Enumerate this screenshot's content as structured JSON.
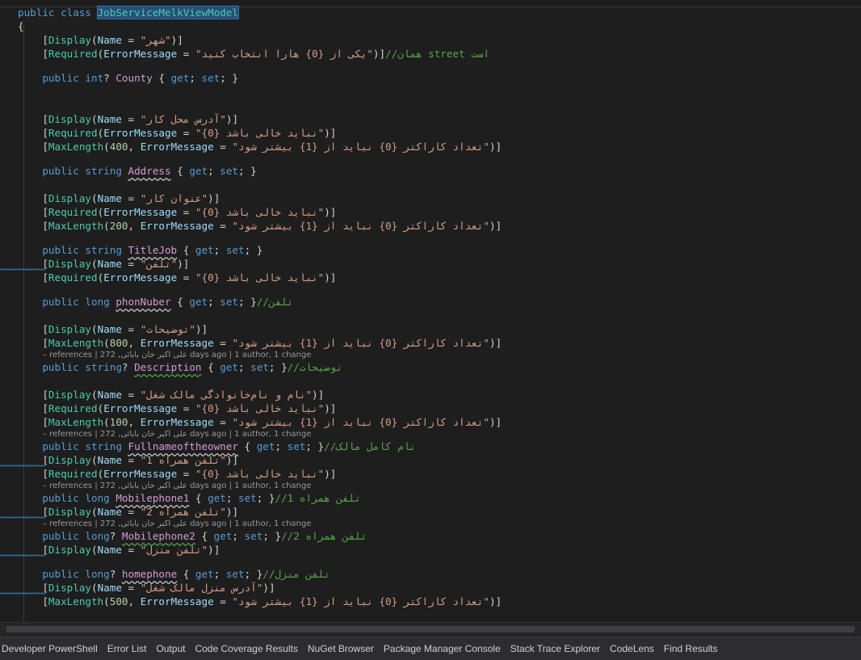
{
  "editor": {
    "lines": [
      [
        [
          "k",
          "public class "
        ],
        [
          "sel",
          "JobServiceMelkViewModel"
        ]
      ],
      [
        [
          "bk",
          "{"
        ]
      ],
      [
        [
          "bk",
          "    ["
        ],
        [
          "a",
          "Display"
        ],
        [
          "bk",
          "("
        ],
        [
          "n",
          "Name"
        ],
        [
          "bk",
          " = "
        ],
        [
          "s",
          "\"شهر\""
        ],
        [
          "bk",
          ")]"
        ]
      ],
      [
        [
          "bk",
          "    ["
        ],
        [
          "a",
          "Required"
        ],
        [
          "bk",
          "("
        ],
        [
          "n",
          "ErrorMessage"
        ],
        [
          "bk",
          " = "
        ],
        [
          "s",
          "\"یکی از {0} هارا انتخاب کنید\""
        ],
        [
          "bk",
          ")]"
        ],
        [
          "c",
          "//همان street است"
        ]
      ],
      [],
      [
        [
          "k",
          "    public int"
        ],
        [
          "bk",
          "? "
        ],
        [
          "p",
          "County"
        ],
        [
          "bk",
          " { "
        ],
        [
          "k",
          "get"
        ],
        [
          "bk",
          "; "
        ],
        [
          "k",
          "set"
        ],
        [
          "bk",
          "; }"
        ]
      ],
      [],
      [],
      [],
      [
        [
          "bk",
          "    ["
        ],
        [
          "a",
          "Display"
        ],
        [
          "bk",
          "("
        ],
        [
          "n",
          "Name"
        ],
        [
          "bk",
          " = "
        ],
        [
          "s",
          "\"آدرس محل کار\""
        ],
        [
          "bk",
          ")]"
        ]
      ],
      [
        [
          "bk",
          "    ["
        ],
        [
          "a",
          "Required"
        ],
        [
          "bk",
          "("
        ],
        [
          "n",
          "ErrorMessage"
        ],
        [
          "bk",
          " = "
        ],
        [
          "s",
          "\"{0} نباید خالی باشد\""
        ],
        [
          "bk",
          ")]"
        ]
      ],
      [
        [
          "bk",
          "    ["
        ],
        [
          "a",
          "MaxLength"
        ],
        [
          "bk",
          "("
        ],
        [
          "num",
          "400"
        ],
        [
          "bk",
          ", "
        ],
        [
          "n",
          "ErrorMessage"
        ],
        [
          "bk",
          " = "
        ],
        [
          "s",
          "\"تعداد کاراکتر {0} نباید از {1} بیشتر شود\""
        ],
        [
          "bk",
          ")]"
        ]
      ],
      [],
      [
        [
          "k",
          "    public string "
        ],
        [
          "p",
          "Address"
        ],
        [
          "bk",
          " { "
        ],
        [
          "k",
          "get"
        ],
        [
          "bk",
          "; "
        ],
        [
          "k",
          "set"
        ],
        [
          "bk",
          "; }"
        ]
      ],
      [],
      [
        [
          "bk",
          "    ["
        ],
        [
          "a",
          "Display"
        ],
        [
          "bk",
          "("
        ],
        [
          "n",
          "Name"
        ],
        [
          "bk",
          " = "
        ],
        [
          "s",
          "\"عنوان کار\""
        ],
        [
          "bk",
          ")]"
        ]
      ],
      [
        [
          "bk",
          "    ["
        ],
        [
          "a",
          "Required"
        ],
        [
          "bk",
          "("
        ],
        [
          "n",
          "ErrorMessage"
        ],
        [
          "bk",
          " = "
        ],
        [
          "s",
          "\"{0} نباید خالی باشد\""
        ],
        [
          "bk",
          ")]"
        ]
      ],
      [
        [
          "bk",
          "    ["
        ],
        [
          "a",
          "MaxLength"
        ],
        [
          "bk",
          "("
        ],
        [
          "num",
          "200"
        ],
        [
          "bk",
          ", "
        ],
        [
          "n",
          "ErrorMessage"
        ],
        [
          "bk",
          " = "
        ],
        [
          "s",
          "\"تعداد کاراکتر {0} نباید از {1} بیشتر شود\""
        ],
        [
          "bk",
          ")]"
        ]
      ],
      [],
      [
        [
          "k",
          "    public string "
        ],
        [
          "p",
          "TitleJob"
        ],
        [
          "bk",
          " { "
        ],
        [
          "k",
          "get"
        ],
        [
          "bk",
          "; "
        ],
        [
          "k",
          "set"
        ],
        [
          "bk",
          "; }"
        ]
      ],
      [
        [
          "bk",
          "    ["
        ],
        [
          "a",
          "Display"
        ],
        [
          "bk",
          "("
        ],
        [
          "n",
          "Name"
        ],
        [
          "bk",
          " = "
        ],
        [
          "s",
          "\"تلفن\""
        ],
        [
          "bk",
          ")]"
        ]
      ],
      [
        [
          "bk",
          "    ["
        ],
        [
          "a",
          "Required"
        ],
        [
          "bk",
          "("
        ],
        [
          "n",
          "ErrorMessage"
        ],
        [
          "bk",
          " = "
        ],
        [
          "s",
          "\"{0} نباید خالی باشد\""
        ],
        [
          "bk",
          ")]"
        ]
      ],
      [],
      [
        [
          "k",
          "    public long "
        ],
        [
          "p",
          "phonNuber"
        ],
        [
          "bk",
          " { "
        ],
        [
          "k",
          "get"
        ],
        [
          "bk",
          "; "
        ],
        [
          "k",
          "set"
        ],
        [
          "bk",
          "; }"
        ],
        [
          "c",
          "//تلفن"
        ]
      ],
      [],
      [
        [
          "bk",
          "    ["
        ],
        [
          "a",
          "Display"
        ],
        [
          "bk",
          "("
        ],
        [
          "n",
          "Name"
        ],
        [
          "bk",
          " = "
        ],
        [
          "s",
          "\"توضیحات\""
        ],
        [
          "bk",
          ")]"
        ]
      ],
      [
        [
          "bk",
          "    ["
        ],
        [
          "a",
          "MaxLength"
        ],
        [
          "bk",
          "("
        ],
        [
          "num",
          "800"
        ],
        [
          "bk",
          ", "
        ],
        [
          "n",
          "ErrorMessage"
        ],
        [
          "bk",
          " = "
        ],
        [
          "s",
          "\"تعداد کاراکتر {0} نباید از {1} بیشتر شود\""
        ],
        [
          "bk",
          ")]"
        ]
      ],
      [
        [
          "k",
          "    public string"
        ],
        [
          "bk",
          "? "
        ],
        [
          "p",
          "Description"
        ],
        [
          "bk",
          " { "
        ],
        [
          "k",
          "get"
        ],
        [
          "bk",
          "; "
        ],
        [
          "k",
          "set"
        ],
        [
          "bk",
          "; }"
        ],
        [
          "c",
          "//توضیحات"
        ]
      ],
      [],
      [
        [
          "bk",
          "    ["
        ],
        [
          "a",
          "Display"
        ],
        [
          "bk",
          "("
        ],
        [
          "n",
          "Name"
        ],
        [
          "bk",
          " = "
        ],
        [
          "s",
          "\"نام و نام‌خانوادگی مالک شغل\""
        ],
        [
          "bk",
          ")]"
        ]
      ],
      [
        [
          "bk",
          "    ["
        ],
        [
          "a",
          "Required"
        ],
        [
          "bk",
          "("
        ],
        [
          "n",
          "ErrorMessage"
        ],
        [
          "bk",
          " = "
        ],
        [
          "s",
          "\"{0} نباید خالی باشد\""
        ],
        [
          "bk",
          ")]"
        ]
      ],
      [
        [
          "bk",
          "    ["
        ],
        [
          "a",
          "MaxLength"
        ],
        [
          "bk",
          "("
        ],
        [
          "num",
          "100"
        ],
        [
          "bk",
          ", "
        ],
        [
          "n",
          "ErrorMessage"
        ],
        [
          "bk",
          " = "
        ],
        [
          "s",
          "\"تعداد کاراکتر {0} نباید از {1} بیشتر شود\""
        ],
        [
          "bk",
          ")]"
        ]
      ],
      [
        [
          "k",
          "    public string "
        ],
        [
          "p",
          "Fullnameoftheowner"
        ],
        [
          "bk",
          " { "
        ],
        [
          "k",
          "get"
        ],
        [
          "bk",
          "; "
        ],
        [
          "k",
          "set"
        ],
        [
          "bk",
          "; }"
        ],
        [
          "c",
          "//نام کامل مالک"
        ]
      ],
      [
        [
          "bk",
          "    ["
        ],
        [
          "a",
          "Display"
        ],
        [
          "bk",
          "("
        ],
        [
          "n",
          "Name"
        ],
        [
          "bk",
          " = "
        ],
        [
          "s",
          "\"تلفن همراه 1\""
        ],
        [
          "bk",
          ")]"
        ]
      ],
      [
        [
          "bk",
          "    ["
        ],
        [
          "a",
          "Required"
        ],
        [
          "bk",
          "("
        ],
        [
          "n",
          "ErrorMessage"
        ],
        [
          "bk",
          " = "
        ],
        [
          "s",
          "\"{0} نباید خالی باشد\""
        ],
        [
          "bk",
          ")]"
        ]
      ],
      [
        [
          "k",
          "    public long "
        ],
        [
          "p",
          "Mobilephone1"
        ],
        [
          "bk",
          " { "
        ],
        [
          "k",
          "get"
        ],
        [
          "bk",
          "; "
        ],
        [
          "k",
          "set"
        ],
        [
          "bk",
          "; }"
        ],
        [
          "c",
          "//تلفن همراه 1"
        ]
      ],
      [
        [
          "bk",
          "    ["
        ],
        [
          "a",
          "Display"
        ],
        [
          "bk",
          "("
        ],
        [
          "n",
          "Name"
        ],
        [
          "bk",
          " = "
        ],
        [
          "s",
          "\"تلفن همراه 2\""
        ],
        [
          "bk",
          ")]"
        ]
      ],
      [
        [
          "k",
          "    public long"
        ],
        [
          "bk",
          "? "
        ],
        [
          "p",
          "Mobilephone2"
        ],
        [
          "bk",
          " { "
        ],
        [
          "k",
          "get"
        ],
        [
          "bk",
          "; "
        ],
        [
          "k",
          "set"
        ],
        [
          "bk",
          "; }"
        ],
        [
          "c",
          "//تلفن همراه 2"
        ]
      ],
      [
        [
          "bk",
          "    ["
        ],
        [
          "a",
          "Display"
        ],
        [
          "bk",
          "("
        ],
        [
          "n",
          "Name"
        ],
        [
          "bk",
          " = "
        ],
        [
          "s",
          "\"تلفن منزل\""
        ],
        [
          "bk",
          ")]"
        ]
      ],
      [],
      [
        [
          "k",
          "    public long"
        ],
        [
          "bk",
          "? "
        ],
        [
          "p",
          "homephone"
        ],
        [
          "bk",
          " { "
        ],
        [
          "k",
          "get"
        ],
        [
          "bk",
          "; "
        ],
        [
          "k",
          "set"
        ],
        [
          "bk",
          "; }"
        ],
        [
          "c",
          "//تلفن منزل"
        ]
      ],
      [
        [
          "bk",
          "    ["
        ],
        [
          "a",
          "Display"
        ],
        [
          "bk",
          "("
        ],
        [
          "n",
          "Name"
        ],
        [
          "bk",
          " = "
        ],
        [
          "s",
          "\"آدرس منزل مالک شغل\""
        ],
        [
          "bk",
          ")]"
        ]
      ],
      [
        [
          "bk",
          "    ["
        ],
        [
          "a",
          "MaxLength"
        ],
        [
          "bk",
          "("
        ],
        [
          "num",
          "500"
        ],
        [
          "bk",
          ", "
        ],
        [
          "n",
          "ErrorMessage"
        ],
        [
          "bk",
          " = "
        ],
        [
          "s",
          "\"تعداد کاراکتر {0} نباید از {1} بیشتر شود\""
        ],
        [
          "bk",
          ")]"
        ]
      ]
    ],
    "codelens": [
      "– references | علی اکبر خان بابائی, 272 days ago | 1 author, 1 change",
      "– references | علی اکبر خان بابائی, 272 days ago | 1 author, 1 change",
      "– references | علی اکبر خان بابائی, 272 days ago | 1 author, 1 change",
      "– references | علی اکبر خان بابائی, 272 days ago | 1 author, 1 change"
    ]
  },
  "bottom_tabs": [
    "Developer PowerShell",
    "Error List",
    "Output",
    "Code Coverage Results",
    "NuGet Browser",
    "Package Manager Console",
    "Stack Trace Explorer",
    "CodeLens",
    "Find Results"
  ],
  "colors": {
    "background": "#1e1e1e",
    "keyword": "#569cd6",
    "type": "#4ec9b0",
    "property": "#d69ad8",
    "string": "#d69d85",
    "comment": "#57a64a"
  }
}
